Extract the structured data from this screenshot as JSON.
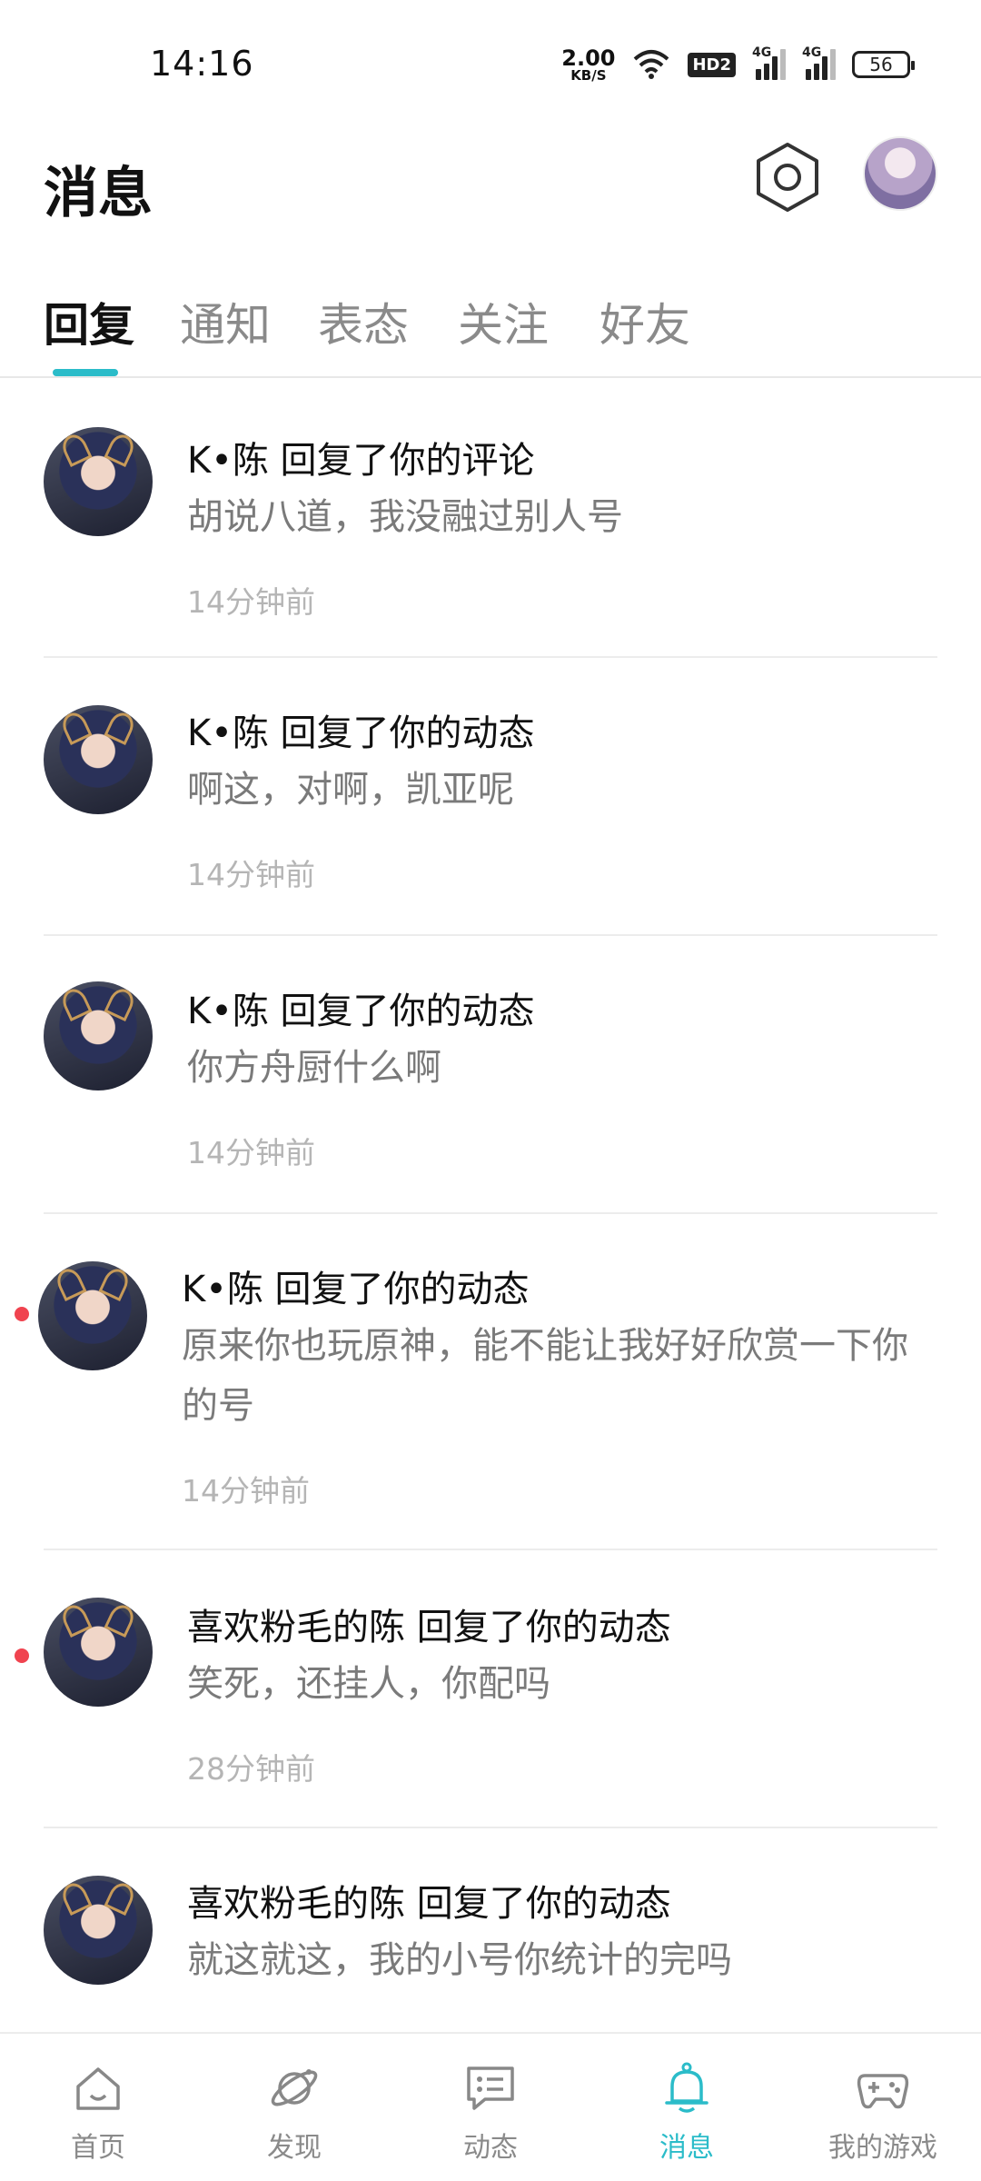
{
  "status_bar": {
    "time": "14:16",
    "net_speed_value": "2.00",
    "net_speed_unit": "KB/S",
    "hd_badge": "HD2",
    "signal1_label": "4G",
    "signal2_label": "4G",
    "battery": "56"
  },
  "header": {
    "title": "消息",
    "settings_icon": "settings-hexagon-icon"
  },
  "tabs": [
    {
      "label": "回复",
      "active": true
    },
    {
      "label": "通知",
      "active": false
    },
    {
      "label": "表态",
      "active": false
    },
    {
      "label": "关注",
      "active": false
    },
    {
      "label": "好友",
      "active": false
    }
  ],
  "messages": [
    {
      "title": "K•陈 回复了你的评论",
      "body": "胡说八道，我没融过别人号",
      "time": "14分钟前",
      "unread": false
    },
    {
      "title": "K•陈 回复了你的动态",
      "body": "啊这，对啊，凯亚呢",
      "time": "14分钟前",
      "unread": false
    },
    {
      "title": "K•陈 回复了你的动态",
      "body": "你方舟厨什么啊",
      "time": "14分钟前",
      "unread": false
    },
    {
      "title": "K•陈 回复了你的动态",
      "body": "原来你也玩原神，能不能让我好好欣赏一下你的号",
      "time": "14分钟前",
      "unread": true
    },
    {
      "title": "喜欢粉毛的陈 回复了你的动态",
      "body": "笑死，还挂人，你配吗",
      "time": "28分钟前",
      "unread": true
    },
    {
      "title": "喜欢粉毛的陈 回复了你的动态",
      "body": "就这就这，我的小号你统计的完吗",
      "time": "",
      "unread": false
    }
  ],
  "bottom_nav": [
    {
      "label": "首页",
      "icon": "home-icon",
      "active": false
    },
    {
      "label": "发现",
      "icon": "planet-icon",
      "active": false
    },
    {
      "label": "动态",
      "icon": "chat-bubble-icon",
      "active": false
    },
    {
      "label": "消息",
      "icon": "bell-icon",
      "active": true
    },
    {
      "label": "我的游戏",
      "icon": "gamepad-icon",
      "active": false
    }
  ],
  "colors": {
    "accent": "#2bbcc9",
    "unread_dot": "#f0434f"
  }
}
